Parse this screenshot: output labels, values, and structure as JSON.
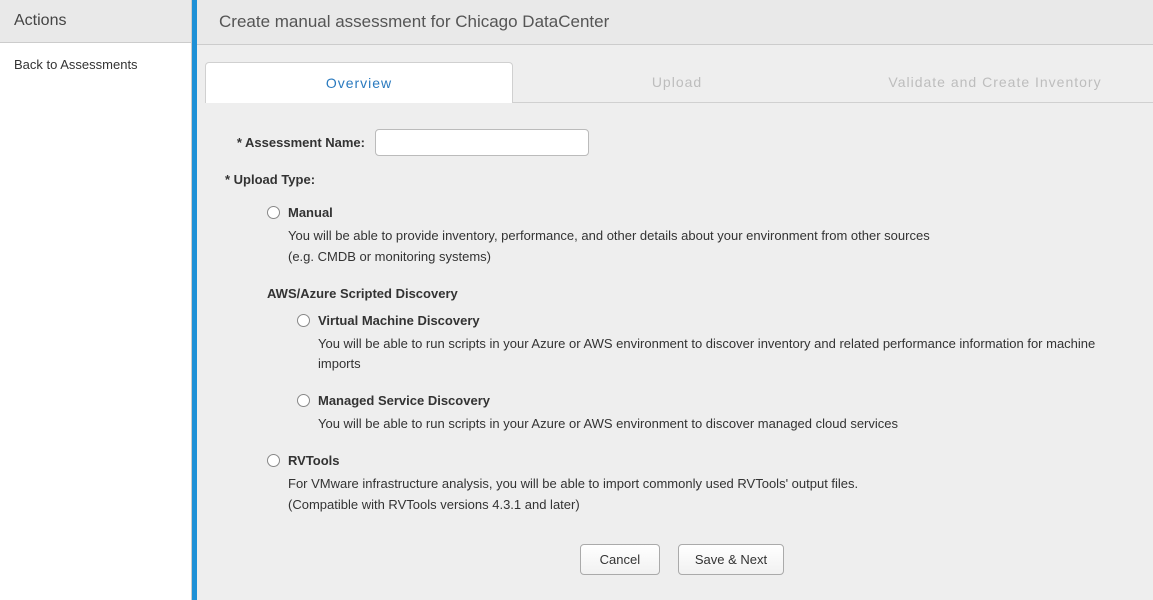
{
  "sidebar": {
    "title": "Actions",
    "back_link": "Back to Assessments"
  },
  "header": {
    "title": "Create manual assessment for Chicago DataCenter"
  },
  "tabs": {
    "overview": "Overview",
    "upload": "Upload",
    "validate": "Validate and Create Inventory"
  },
  "form": {
    "assessment_name_label": "* Assessment Name:",
    "assessment_name_value": "",
    "upload_type_label": "* Upload Type:",
    "manual": {
      "title": "Manual",
      "desc1": "You will be able to provide inventory, performance, and other details about your environment from other sources",
      "desc2": "(e.g. CMDB or monitoring systems)"
    },
    "scripted_heading": "AWS/Azure Scripted Discovery",
    "vm": {
      "title": "Virtual Machine Discovery",
      "desc": "You will be able to run scripts in your Azure or AWS environment to discover inventory and related performance information for machine imports"
    },
    "managed": {
      "title": "Managed Service Discovery",
      "desc": "You will be able to run scripts in your Azure or AWS environment to discover managed cloud services"
    },
    "rvtools": {
      "title": "RVTools",
      "desc1": "For VMware infrastructure analysis, you will be able to import commonly used RVTools' output files.",
      "desc2": "(Compatible with RVTools versions 4.3.1 and later)"
    },
    "cancel_label": "Cancel",
    "save_next_label": "Save & Next"
  }
}
